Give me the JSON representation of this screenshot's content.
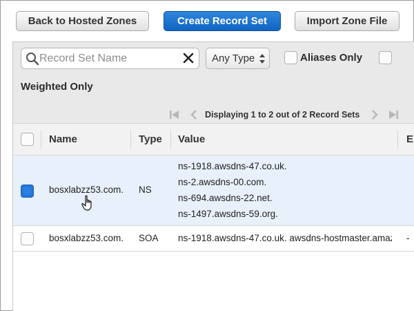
{
  "top_buttons": {
    "back": "Back to Hosted Zones",
    "create": "Create Record Set",
    "import": "Import Zone File"
  },
  "filter": {
    "search_placeholder": "Record Set Name",
    "type_select": "Any Type",
    "aliases_only": "Aliases Only",
    "weighted_only": "Weighted Only"
  },
  "pagination": {
    "text": "Displaying 1 to 2 out of 2 Record Sets"
  },
  "table": {
    "columns": [
      "Name",
      "Type",
      "Value",
      "E"
    ],
    "rows": [
      {
        "selected": true,
        "name": "bosxlabzz53.com.",
        "type": "NS",
        "values": [
          "ns-1918.awsdns-47.co.uk.",
          "ns-2.awsdns-00.com.",
          "ns-694.awsdns-22.net.",
          "ns-1497.awsdns-59.org."
        ],
        "extra": ""
      },
      {
        "selected": false,
        "name": "bosxlabzz53.com.",
        "type": "SOA",
        "values": [
          "ns-1918.awsdns-47.co.uk. awsdns-hostmaster.amaz"
        ],
        "extra": "-"
      }
    ]
  },
  "colors": {
    "primary_button": "#1a6fd0",
    "selected_row": "#e8f0fb",
    "toolbar": "#e9e9e9"
  },
  "icons": [
    "search-icon",
    "clear-icon",
    "select-arrows-icon",
    "first-page-icon",
    "prev-page-icon",
    "next-page-icon",
    "last-page-icon",
    "hand-cursor-icon"
  ]
}
